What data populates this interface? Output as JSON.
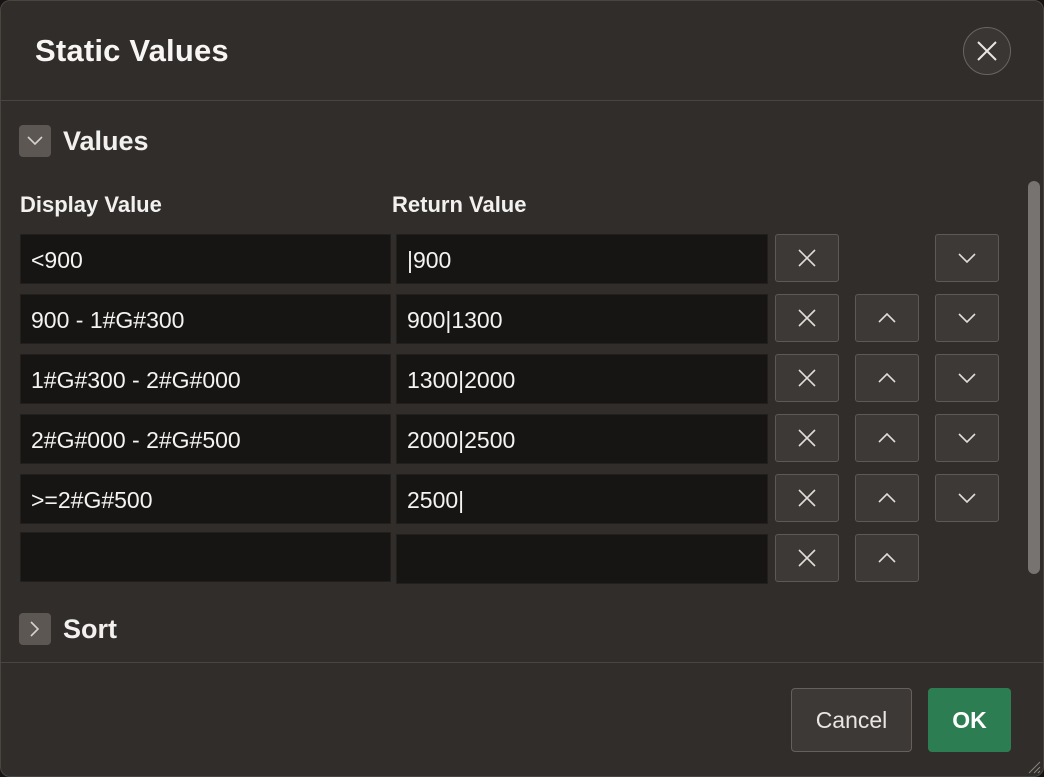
{
  "dialog": {
    "title": "Static Values",
    "close_icon": "close-icon"
  },
  "sections": {
    "values": {
      "label": "Values",
      "expanded": true,
      "icon": "chevron-down-icon"
    },
    "sort": {
      "label": "Sort",
      "expanded": false,
      "icon": "chevron-right-icon"
    }
  },
  "columns": {
    "display": "Display Value",
    "return": "Return Value"
  },
  "rows": [
    {
      "display": "<900",
      "return": "|900"
    },
    {
      "display": "900 - 1#G#300",
      "return": "900|1300"
    },
    {
      "display": "1#G#300 - 2#G#000",
      "return": "1300|2000"
    },
    {
      "display": "2#G#000 - 2#G#500",
      "return": "2000|2500"
    },
    {
      "display": ">=2#G#500",
      "return": "2500|"
    },
    {
      "display": "",
      "return": ""
    }
  ],
  "row_actions": {
    "delete_icon": "close-icon",
    "up_icon": "chevron-up-icon",
    "down_icon": "chevron-down-icon"
  },
  "footer": {
    "cancel_label": "Cancel",
    "ok_label": "OK"
  },
  "colors": {
    "dialog_bg": "#312d2a",
    "field_bg": "#161513",
    "ok_bg": "#2d7d52"
  }
}
